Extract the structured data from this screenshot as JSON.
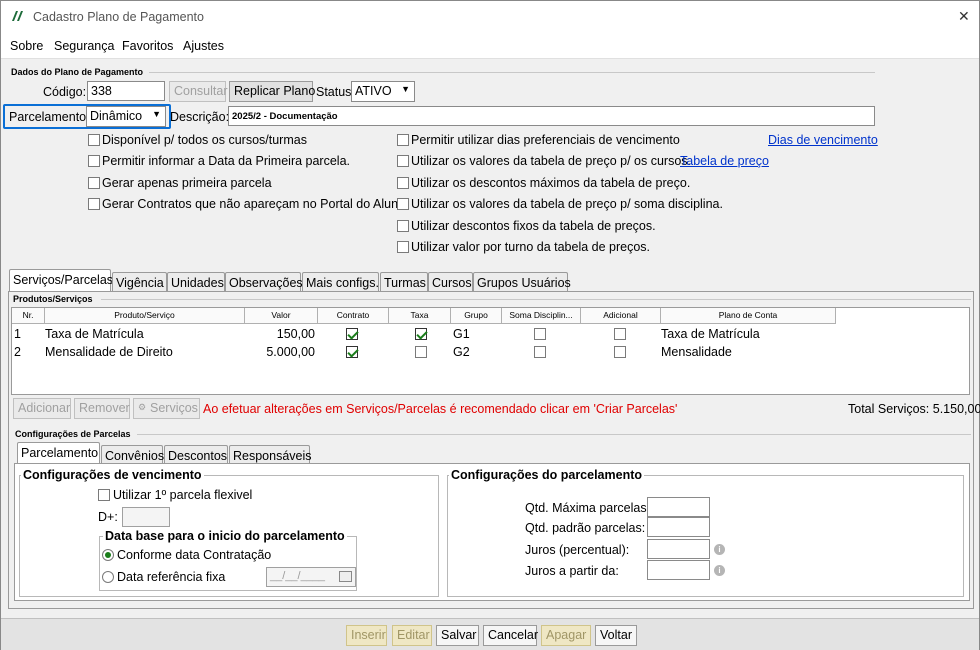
{
  "window": {
    "title": "Cadastro Plano de Pagamento",
    "close_label": "✕"
  },
  "menu": [
    {
      "label": "Sobre"
    },
    {
      "label": "Segurança"
    },
    {
      "label": "Favoritos"
    },
    {
      "label": "Ajustes"
    }
  ],
  "plan": {
    "group_label": "Dados do Plano de Pagamento",
    "codigo_label": "Código:",
    "codigo_value": "338",
    "consultar_label": "Consultar",
    "replicar_label": "Replicar Plano",
    "status_label": "Status:",
    "status_value": "ATIVO",
    "parcelamento_label": "Parcelamento:",
    "parcelamento_value": "Dinâmico",
    "descricao_label": "Descrição:*",
    "descricao_value": "2025/2 - Documentação"
  },
  "options_left": [
    {
      "label": "Disponível p/ todos os cursos/turmas",
      "checked": false
    },
    {
      "label": "Permitir informar a Data da Primeira parcela.",
      "checked": false
    },
    {
      "label": "Gerar apenas primeira parcela",
      "checked": false
    },
    {
      "label": "Gerar Contratos que não apareçam no Portal do Aluno.",
      "checked": false
    }
  ],
  "options_right": [
    {
      "label": "Permitir utilizar dias preferenciais de vencimento",
      "checked": false
    },
    {
      "label": "Utilizar os valores da tabela de preço p/ os cursos.",
      "checked": false
    },
    {
      "label": "Utilizar os descontos máximos da tabela de preço.",
      "checked": false
    },
    {
      "label": "Utilizar os valores da tabela de preço p/ soma disciplina.",
      "checked": false
    },
    {
      "label": "Utilizar descontos fixos da tabela de preços.",
      "checked": false
    },
    {
      "label": "Utilizar valor por turno da tabela de preços.",
      "checked": false
    }
  ],
  "links": {
    "dias_vencimento": "Dias de vencimento",
    "tabela_preco": "Tabela de preço"
  },
  "main_tabs": [
    {
      "label": "Serviços/Parcelas",
      "selected": true
    },
    {
      "label": "Vigência"
    },
    {
      "label": "Unidades"
    },
    {
      "label": "Observações"
    },
    {
      "label": "Mais configs."
    },
    {
      "label": "Turmas"
    },
    {
      "label": "Cursos"
    },
    {
      "label": "Grupos Usuários"
    }
  ],
  "produtos": {
    "group_label": "Produtos/Serviços",
    "columns": [
      "Nr.",
      "Produto/Serviço",
      "Valor",
      "Contrato",
      "Taxa",
      "Grupo",
      "Soma Disciplin...",
      "Adicional",
      "Plano de Conta"
    ],
    "rows": [
      {
        "nr": "1",
        "produto": "Taxa de Matrícula",
        "valor": "150,00",
        "contrato": true,
        "taxa": true,
        "grupo": "G1",
        "soma": false,
        "adicional": false,
        "plano": "Taxa de Matrícula"
      },
      {
        "nr": "2",
        "produto": "Mensalidade de Direito",
        "valor": "5.000,00",
        "contrato": true,
        "taxa": false,
        "grupo": "G2",
        "soma": false,
        "adicional": false,
        "plano": "Mensalidade"
      }
    ],
    "adicionar_label": "Adicionar",
    "remover_label": "Remover",
    "servicos_label": "Serviços",
    "warning": "Ao efetuar alterações em Serviços/Parcelas é recomendado clicar em 'Criar Parcelas'",
    "total": "Total Serviços: 5.150,00"
  },
  "config": {
    "group_label": "Configurações de Parcelas",
    "tabs": [
      {
        "label": "Parcelamento",
        "selected": true
      },
      {
        "label": "Convênios"
      },
      {
        "label": "Descontos"
      },
      {
        "label": "Responsáveis"
      }
    ],
    "vencimento_title": "Configurações de vencimento",
    "flexivel_label": "Utilizar 1º parcela flexivel",
    "dplus_label": "D+:",
    "data_base_title": "Data base para o inicio do parcelamento",
    "radio_contratacao": "Conforme data Contratação",
    "radio_fixa": "Data referência fixa",
    "date_placeholder": "__/__/____",
    "parcelamento_title": "Configurações do parcelamento",
    "qtd_max_label": "Qtd. Máxima parcelas:",
    "qtd_padrao_label": "Qtd. padrão parcelas:",
    "juros_label": "Juros (percentual):",
    "juros_partir_label": "Juros a partir da:"
  },
  "footer": [
    {
      "label": "Inserir",
      "disabled": true
    },
    {
      "label": "Editar",
      "disabled": true
    },
    {
      "label": "Salvar",
      "disabled": false
    },
    {
      "label": "Cancelar",
      "disabled": false
    },
    {
      "label": "Apagar",
      "disabled": true
    },
    {
      "label": "Voltar",
      "disabled": false
    }
  ],
  "colors": {
    "accent": "#0a6fd6",
    "warning": "#e00000",
    "check": "#1a7d1a",
    "logo": "#1d6b3a"
  }
}
